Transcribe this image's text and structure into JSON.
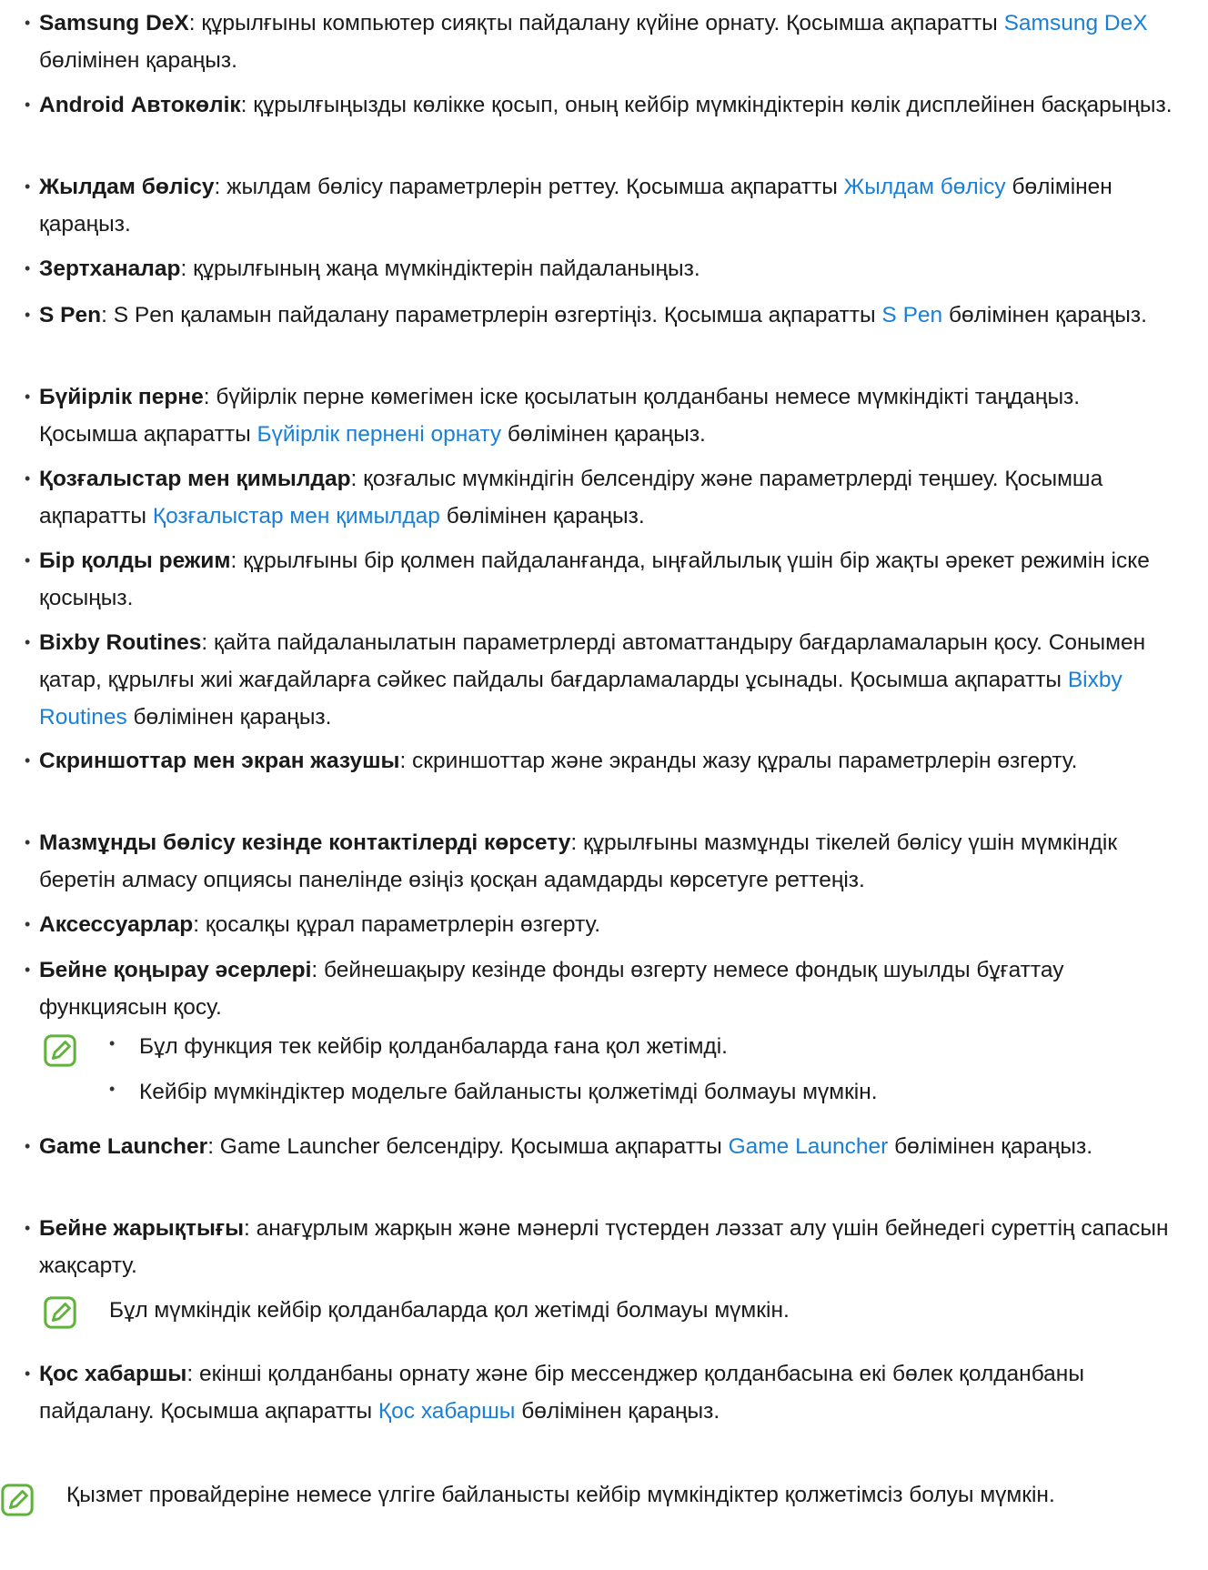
{
  "items": [
    {
      "title": "Samsung DeX",
      "text": ": құрылғыны компьютер сияқты пайдалану күйіне орнату. Қосымша ақпаратты ",
      "link": "Samsung DeX",
      "after": " бөлімінен қараңыз."
    },
    {
      "title": "Android Автокөлік",
      "text": ": құрылғыңызды көлікке қосып, оның кейбір мүмкіндіктерін көлік дисплейінен басқарыңыз.",
      "link": "",
      "after": ""
    },
    {
      "title": "Жылдам бөлісу",
      "text": ": жылдам бөлісу параметрлерін реттеу. Қосымша ақпаратты ",
      "link": "Жылдам бөлісу",
      "after": " бөлімінен қараңыз."
    },
    {
      "title": "Зертханалар",
      "text": ": құрылғының жаңа мүмкіндіктерін пайдаланыңыз.",
      "link": "",
      "after": ""
    },
    {
      "title": "S Pen",
      "text": ": S Pen қаламын пайдалану параметрлерін өзгертіңіз. Қосымша ақпаратты ",
      "link": "S Pen",
      "after": " бөлімінен қараңыз."
    },
    {
      "title": "Бүйірлік перне",
      "text": ": бүйірлік перне көмегімен іске қосылатын қолданбаны немесе мүмкіндікті таңдаңыз. Қосымша ақпаратты ",
      "link": "Бүйірлік пернені орнату",
      "after": " бөлімінен қараңыз."
    },
    {
      "title": "Қозғалыстар мен қимылдар",
      "text": ": қозғалыс мүмкіндігін белсендіру және параметрлерді теңшеу. Қосымша ақпаратты ",
      "link": "Қозғалыстар мен қимылдар",
      "after": " бөлімінен қараңыз."
    },
    {
      "title": "Бір қолды режим",
      "text": ": құрылғыны бір қолмен пайдаланғанда, ыңғайлылық үшін бір жақты әрекет режимін іске қосыңыз.",
      "link": "",
      "after": ""
    },
    {
      "title": "Bixby Routines",
      "text": ": қайта пайдаланылатын параметрлерді автоматтандыру бағдарламаларын қосу. Сонымен қатар, құрылғы жиі жағдайларға сәйкес пайдалы бағдарламаларды ұсынады. Қосымша ақпаратты ",
      "link": "Bixby Routines",
      "after": " бөлімінен қараңыз."
    },
    {
      "title": "Скриншоттар мен экран жазушы",
      "text": ": скриншоттар және экранды жазу құралы параметрлерін өзгерту.",
      "link": "",
      "after": ""
    },
    {
      "title": "Мазмұнды бөлісу кезінде контактілерді көрсету",
      "text": ": құрылғыны мазмұнды тікелей бөлісу үшін мүмкіндік беретін алмасу опциясы панелінде өзіңіз қосқан адамдарды көрсетуге реттеңіз.",
      "link": "",
      "after": ""
    },
    {
      "title": "Аксессуарлар",
      "text": ": қосалқы құрал параметрлерін өзгерту.",
      "link": "",
      "after": ""
    },
    {
      "title": "Бейне қоңырау әсерлері",
      "text": ": бейнешақыру кезінде фонды өзгерту немесе фондық шуылды бұғаттау функциясын қосу.",
      "link": "",
      "after": ""
    },
    {
      "title": "Game Launcher",
      "text": ": Game Launcher белсендіру. Қосымша ақпаратты ",
      "link": "Game Launcher",
      "after": " бөлімінен қараңыз."
    },
    {
      "title": "Бейне жарықтығы",
      "text": ": анағұрлым жарқын және мәнерлі түстерден ләззат алу үшін бейнедегі суреттің сапасын жақсарту.",
      "link": "",
      "after": ""
    },
    {
      "title": "Қос хабаршы",
      "text": ": екінші қолданбаны орнату және бір мессенджер қолданбасына екі бөлек қолданбаны пайдалану. Қосымша ақпаратты ",
      "link": "Қос хабаршы",
      "after": " бөлімінен қараңыз."
    }
  ],
  "note_video_call": [
    "Бұл функция тек кейбір қолданбаларда ғана қол жетімді.",
    "Кейбір мүмкіндіктер модельге байланысты қолжетімді болмауы мүмкін."
  ],
  "note_video_brightness": "Бұл мүмкіндік кейбір қолданбаларда қол жетімді болмауы мүмкін.",
  "note_footer": "Қызмет провайдеріне немесе үлгіге байланысты кейбір мүмкіндіктер қолжетімсіз болуы мүмкін.",
  "colors": {
    "link": "#1a7fd6",
    "note_icon": "#5fb33a"
  },
  "icon": "note-pencil-icon"
}
